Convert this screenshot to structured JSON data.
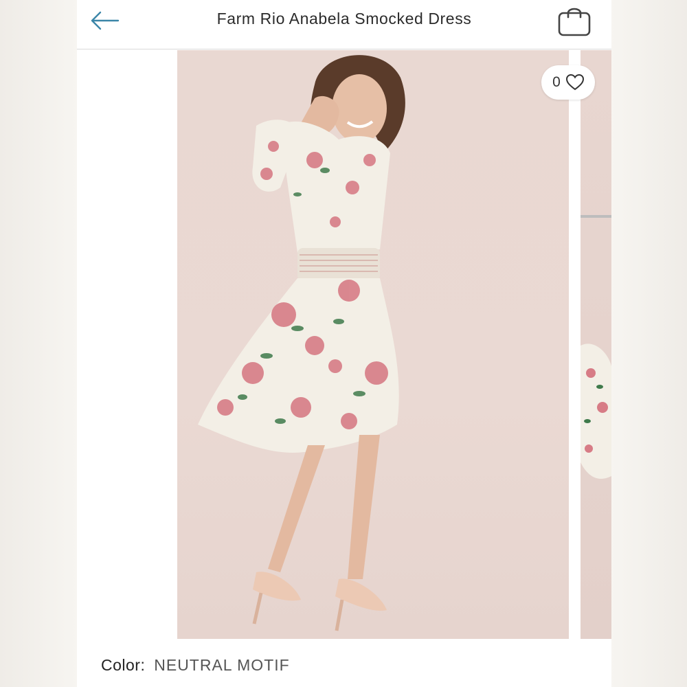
{
  "header": {
    "title": "Farm Rio Anabela Smocked Dress",
    "back_icon": "arrow-left-icon",
    "bag_icon": "shopping-bag-icon"
  },
  "product_image": {
    "favorite_count": "0",
    "favorite_icon": "heart-outline-icon"
  },
  "details": {
    "color_label": "Color:",
    "color_value": "NEUTRAL MOTIF"
  },
  "colors": {
    "accent": "#3b86a8",
    "background": "#e9d8d2",
    "divider": "#d9d9d9"
  }
}
